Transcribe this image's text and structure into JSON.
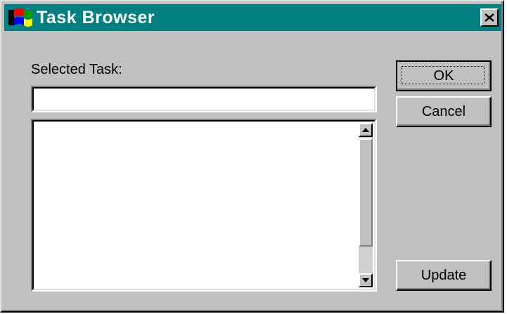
{
  "window": {
    "title": "Task Browser",
    "title_icon": "windows-flag-icon",
    "close_icon": "close-icon"
  },
  "form": {
    "selected_task_label": "Selected Task:",
    "selected_task_value": "",
    "task_list_items": []
  },
  "buttons": {
    "ok": "OK",
    "cancel": "Cancel",
    "update": "Update"
  },
  "colors": {
    "titlebar": "#008080",
    "face": "#c0c0c0"
  }
}
